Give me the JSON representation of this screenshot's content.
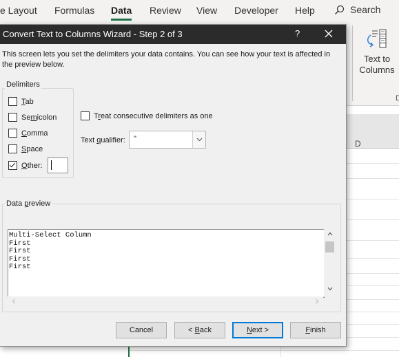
{
  "ribbon": {
    "tabs": [
      {
        "label": "e Layout"
      },
      {
        "label": "Formulas"
      },
      {
        "label": "Data",
        "active": true
      },
      {
        "label": "Review"
      },
      {
        "label": "View"
      },
      {
        "label": "Developer"
      },
      {
        "label": "Help"
      }
    ],
    "search_label": "Search",
    "text_to_columns": {
      "line1": "Text to",
      "line2": "Columns",
      "icon": "text-to-columns-icon"
    },
    "overflow_char": "D"
  },
  "sheet": {
    "column_header": "D",
    "accent_color": "#217346"
  },
  "dialog": {
    "title": "Convert Text to Columns Wizard - Step 2 of 3",
    "help": "?",
    "intro": "This screen lets you set the delimiters your data contains.  You can see how your text is affected in the preview below.",
    "delimiters_group": "Delimiters",
    "delimiters": {
      "tab": {
        "pre": "",
        "key": "T",
        "post": "ab",
        "checked": false
      },
      "semicolon": {
        "pre": "Se",
        "key": "m",
        "post": "icolon",
        "checked": false
      },
      "comma": {
        "pre": "",
        "key": "C",
        "post": "omma",
        "checked": false
      },
      "space": {
        "pre": "",
        "key": "S",
        "post": "pace",
        "checked": false
      },
      "other": {
        "pre": "",
        "key": "O",
        "post": "ther:",
        "checked": true,
        "value": ""
      }
    },
    "consecutive": {
      "pre": "T",
      "key": "r",
      "post": "eat consecutive delimiters as one",
      "checked": false
    },
    "qualifier": {
      "label_pre": "Text ",
      "label_key": "q",
      "label_post": "ualifier:",
      "value": "\""
    },
    "preview_group": {
      "pre": "Data ",
      "key": "p",
      "post": "review"
    },
    "preview_lines": [
      "Multi-Select Column",
      "First",
      "First",
      "First",
      "First"
    ],
    "buttons": {
      "cancel": {
        "pre": "Cancel",
        "key": "",
        "post": ""
      },
      "back": {
        "pre": "< ",
        "key": "B",
        "post": "ack"
      },
      "next": {
        "pre": "",
        "key": "N",
        "post": "ext >"
      },
      "finish": {
        "pre": "",
        "key": "F",
        "post": "inish"
      }
    },
    "colors": {
      "titlebar": "#2b2b2b",
      "primary_border": "#0078d7"
    }
  }
}
